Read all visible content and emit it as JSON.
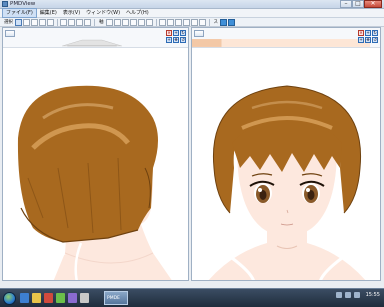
{
  "window": {
    "title": "PMDView"
  },
  "menu": {
    "items": [
      "ファイル(F)",
      "編集(E)",
      "表示(V)",
      "ウィンドウ(W)",
      "ヘルプ(H)"
    ]
  },
  "toolbar": {
    "label_left": "選択",
    "label_mid": "軸",
    "label_right": "ス"
  },
  "panels": {
    "left": {
      "tab": "",
      "close_glyph": "✕"
    },
    "right": {
      "tab": "",
      "close_glyph": "✕"
    }
  },
  "taskbar": {
    "app_label": "PMDE",
    "clock_time": "15:55"
  },
  "colors": {
    "hair": "#a8691f",
    "skin": "#fde8de",
    "viewport_bg": "#ffffff"
  }
}
